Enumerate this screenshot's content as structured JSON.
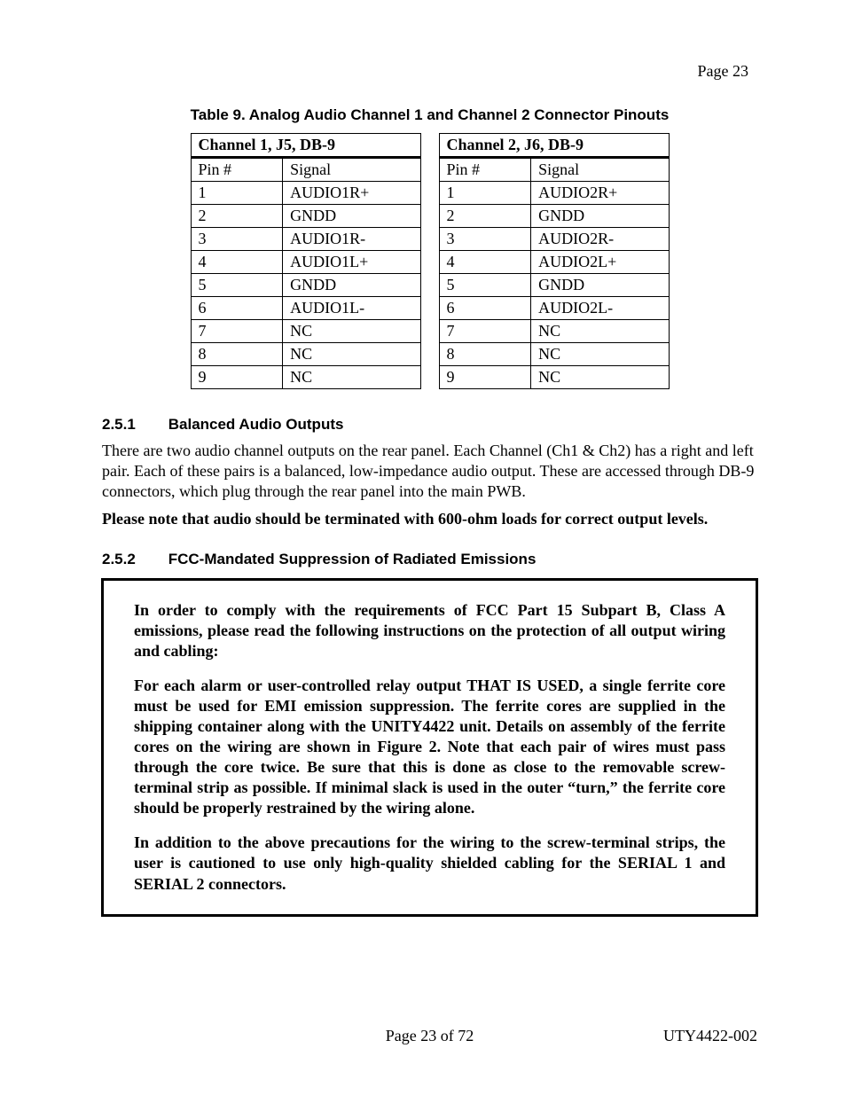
{
  "page_label_top": "Page 23",
  "table_caption": "Table 9.  Analog Audio Channel 1 and Channel 2 Connector Pinouts",
  "tables": {
    "left": {
      "title": "Channel 1, J5, DB-9",
      "col1": "Pin #",
      "col2": "Signal",
      "rows": [
        {
          "pin": "1",
          "sig": "AUDIO1R+"
        },
        {
          "pin": "2",
          "sig": "GNDD"
        },
        {
          "pin": "3",
          "sig": "AUDIO1R-"
        },
        {
          "pin": "4",
          "sig": "AUDIO1L+"
        },
        {
          "pin": "5",
          "sig": "GNDD"
        },
        {
          "pin": "6",
          "sig": "AUDIO1L-"
        },
        {
          "pin": "7",
          "sig": "NC"
        },
        {
          "pin": "8",
          "sig": "NC"
        },
        {
          "pin": "9",
          "sig": "NC"
        }
      ]
    },
    "right": {
      "title": "Channel 2, J6, DB-9",
      "col1": "Pin #",
      "col2": "Signal",
      "rows": [
        {
          "pin": "1",
          "sig": "AUDIO2R+"
        },
        {
          "pin": "2",
          "sig": "GNDD"
        },
        {
          "pin": "3",
          "sig": "AUDIO2R-"
        },
        {
          "pin": "4",
          "sig": "AUDIO2L+"
        },
        {
          "pin": "5",
          "sig": "GNDD"
        },
        {
          "pin": "6",
          "sig": "AUDIO2L-"
        },
        {
          "pin": "7",
          "sig": "NC"
        },
        {
          "pin": "8",
          "sig": "NC"
        },
        {
          "pin": "9",
          "sig": "NC"
        }
      ]
    }
  },
  "sec251": {
    "num": "2.5.1",
    "title": "Balanced Audio Outputs",
    "p1": "There are two audio channel outputs on the rear panel.  Each Channel (Ch1 & Ch2) has a right and left pair.  Each of these pairs is a balanced, low-impedance audio output.  These are accessed through DB-9 connectors, which plug through the rear panel into the main PWB.",
    "note": "Please note that audio should be terminated with 600-ohm loads for correct output levels."
  },
  "sec252": {
    "num": "2.5.2",
    "title": "FCC-Mandated Suppression of Radiated Emissions",
    "box": {
      "p1": "In order to comply with the requirements of FCC Part 15 Subpart B, Class A emissions, please read the following instructions on the protection of all output wiring and cabling:",
      "p2": "For each alarm or user-controlled relay output THAT IS USED, a single ferrite core must be used for EMI emission suppression.  The ferrite cores are supplied in the shipping container along with the UNITY4422 unit.  Details on assembly of the ferrite cores on the wiring are shown in Figure 2.  Note that each pair of wires must pass through the core twice.  Be sure that this is done as close to the removable screw-terminal strip as possible.  If minimal slack is used in the outer “turn,” the ferrite core should be properly restrained by the wiring alone.",
      "p3": "In addition to the above precautions for the wiring to the screw-terminal strips, the user is cautioned to use only high-quality shielded cabling for the SERIAL 1 and SERIAL 2 connectors."
    }
  },
  "footer": {
    "center": "Page 23 of 72",
    "right": "UTY4422-002"
  }
}
